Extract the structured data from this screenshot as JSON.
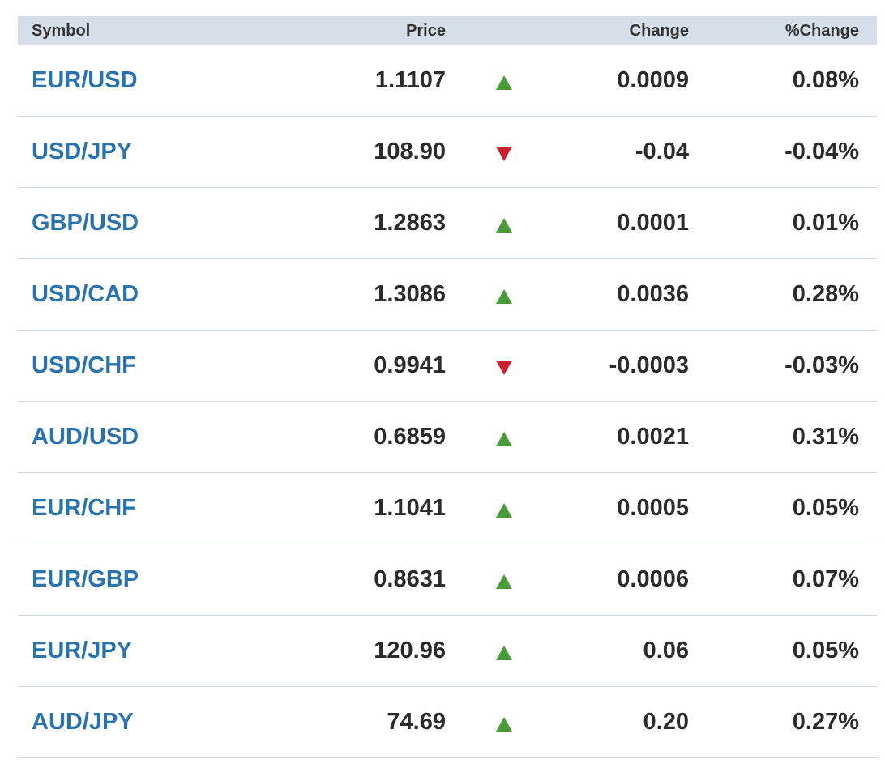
{
  "colors": {
    "header_bg": "#d4dfe9",
    "symbol_link": "#2a73ad",
    "up": "#4a9a3a",
    "down": "#cc1f2f",
    "row_divider": "#d0d8de"
  },
  "table": {
    "headers": {
      "symbol": "Symbol",
      "price": "Price",
      "change": "Change",
      "pct_change": "%Change"
    },
    "rows": [
      {
        "symbol": "EUR/USD",
        "price": "1.1107",
        "direction": "up",
        "icon": "triangle-up-icon",
        "change": "0.0009",
        "pct_change": "0.08%"
      },
      {
        "symbol": "USD/JPY",
        "price": "108.90",
        "direction": "down",
        "icon": "triangle-down-icon",
        "change": "-0.04",
        "pct_change": "-0.04%"
      },
      {
        "symbol": "GBP/USD",
        "price": "1.2863",
        "direction": "up",
        "icon": "triangle-up-icon",
        "change": "0.0001",
        "pct_change": "0.01%"
      },
      {
        "symbol": "USD/CAD",
        "price": "1.3086",
        "direction": "up",
        "icon": "triangle-up-icon",
        "change": "0.0036",
        "pct_change": "0.28%"
      },
      {
        "symbol": "USD/CHF",
        "price": "0.9941",
        "direction": "down",
        "icon": "triangle-down-icon",
        "change": "-0.0003",
        "pct_change": "-0.03%"
      },
      {
        "symbol": "AUD/USD",
        "price": "0.6859",
        "direction": "up",
        "icon": "triangle-up-icon",
        "change": "0.0021",
        "pct_change": "0.31%"
      },
      {
        "symbol": "EUR/CHF",
        "price": "1.1041",
        "direction": "up",
        "icon": "triangle-up-icon",
        "change": "0.0005",
        "pct_change": "0.05%"
      },
      {
        "symbol": "EUR/GBP",
        "price": "0.8631",
        "direction": "up",
        "icon": "triangle-up-icon",
        "change": "0.0006",
        "pct_change": "0.07%"
      },
      {
        "symbol": "EUR/JPY",
        "price": "120.96",
        "direction": "up",
        "icon": "triangle-up-icon",
        "change": "0.06",
        "pct_change": "0.05%"
      },
      {
        "symbol": "AUD/JPY",
        "price": "74.69",
        "direction": "up",
        "icon": "triangle-up-icon",
        "change": "0.20",
        "pct_change": "0.27%"
      }
    ]
  }
}
